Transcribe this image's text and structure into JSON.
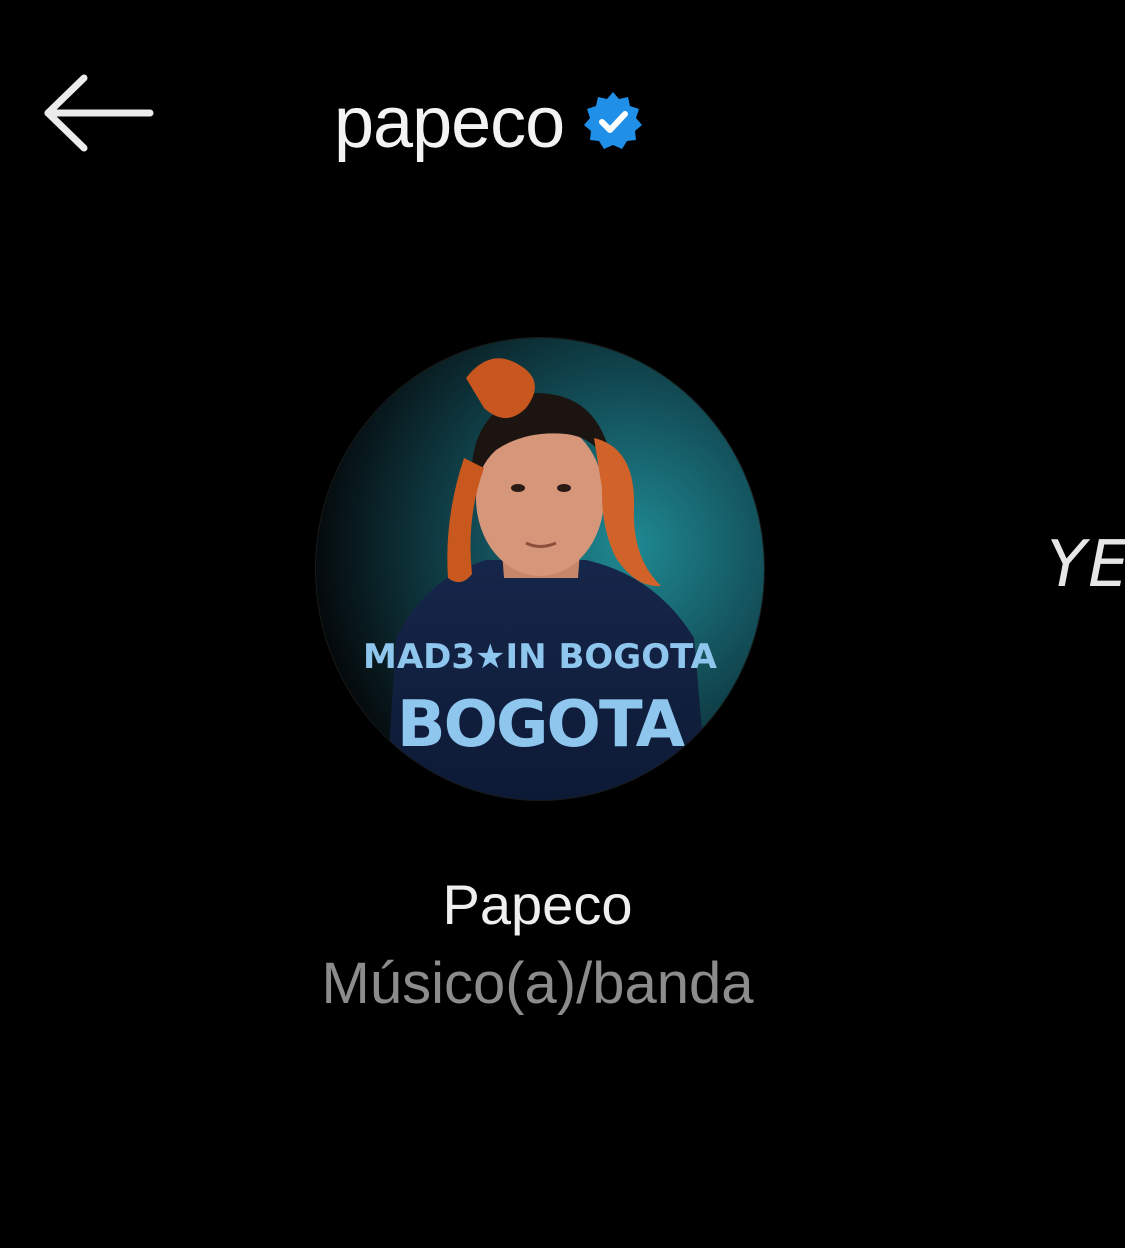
{
  "header": {
    "back_icon": "arrow-left-icon",
    "username": "papeco",
    "verified_icon": "verified-badge-icon",
    "verified_color": "#1f8fe8"
  },
  "profile": {
    "avatar_icon": "profile-photo",
    "shirt_text": "MAD3★IN BOGOTA",
    "display_name": "Papeco",
    "category": "Músico(a)/banda"
  },
  "edge_fragment": "YE"
}
